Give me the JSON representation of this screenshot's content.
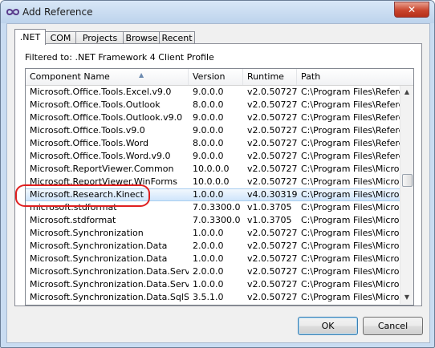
{
  "window": {
    "title": "Add Reference",
    "close_glyph": "✕"
  },
  "tabs": [
    {
      "label": ".NET",
      "active": true
    },
    {
      "label": "COM",
      "active": false
    },
    {
      "label": "Projects",
      "active": false
    },
    {
      "label": "Browse",
      "active": false
    },
    {
      "label": "Recent",
      "active": false
    }
  ],
  "filter": {
    "text": "Filtered to: .NET Framework 4 Client Profile"
  },
  "table": {
    "columns": [
      "Component Name",
      "Version",
      "Runtime",
      "Path"
    ],
    "sort_indicator": "▲",
    "selected_row": 8,
    "rows": [
      [
        "Microsoft.Office.Tools.Excel.v9.0",
        "9.0.0.0",
        "v2.0.50727",
        "C:\\Program Files\\Referenc..."
      ],
      [
        "Microsoft.Office.Tools.Outlook",
        "8.0.0.0",
        "v2.0.50727",
        "C:\\Program Files\\Referenc..."
      ],
      [
        "Microsoft.Office.Tools.Outlook.v9.0",
        "9.0.0.0",
        "v2.0.50727",
        "C:\\Program Files\\Referenc..."
      ],
      [
        "Microsoft.Office.Tools.v9.0",
        "9.0.0.0",
        "v2.0.50727",
        "C:\\Program Files\\Referenc..."
      ],
      [
        "Microsoft.Office.Tools.Word",
        "8.0.0.0",
        "v2.0.50727",
        "C:\\Program Files\\Referenc..."
      ],
      [
        "Microsoft.Office.Tools.Word.v9.0",
        "9.0.0.0",
        "v2.0.50727",
        "C:\\Program Files\\Referenc..."
      ],
      [
        "Microsoft.ReportViewer.Common",
        "10.0.0.0",
        "v2.0.50727",
        "C:\\Program Files\\Microso..."
      ],
      [
        "Microsoft.ReportViewer.WinForms",
        "10.0.0.0",
        "v2.0.50727",
        "C:\\Program Files\\Microso..."
      ],
      [
        "Microsoft.Research.Kinect",
        "1.0.0.0",
        "v4.0.30319",
        "C:\\Program Files\\Microso..."
      ],
      [
        "microsoft.stdformat",
        "7.0.3300.0",
        "v1.0.3705",
        "C:\\Program Files\\Microso..."
      ],
      [
        "Microsoft.stdformat",
        "7.0.3300.0",
        "v1.0.3705",
        "C:\\Program Files\\Microso..."
      ],
      [
        "Microsoft.Synchronization",
        "1.0.0.0",
        "v2.0.50727",
        "C:\\Program Files\\Microso..."
      ],
      [
        "Microsoft.Synchronization.Data",
        "2.0.0.0",
        "v2.0.50727",
        "C:\\Program Files\\Microso..."
      ],
      [
        "Microsoft.Synchronization.Data",
        "1.0.0.0",
        "v2.0.50727",
        "C:\\Program Files\\Microso..."
      ],
      [
        "Microsoft.Synchronization.Data.Server",
        "2.0.0.0",
        "v2.0.50727",
        "C:\\Program Files\\Microso..."
      ],
      [
        "Microsoft.Synchronization.Data.Server",
        "1.0.0.0",
        "v2.0.50727",
        "C:\\Program Files\\Microso..."
      ],
      [
        "Microsoft.Synchronization.Data.SqlServerCe",
        "3.5.1.0",
        "v2.0.50727",
        "C:\\Program Files\\Microso..."
      ]
    ]
  },
  "scrollbar": {
    "up_glyph": "▲",
    "down_glyph": "▼",
    "position": 0.42
  },
  "buttons": {
    "ok": "OK",
    "cancel": "Cancel"
  },
  "annotation": {
    "color": "#e02020"
  },
  "colors": {
    "selection": "#cfe5fb",
    "window_frame": "#c9dcf1",
    "close_button": "#c9452d"
  }
}
